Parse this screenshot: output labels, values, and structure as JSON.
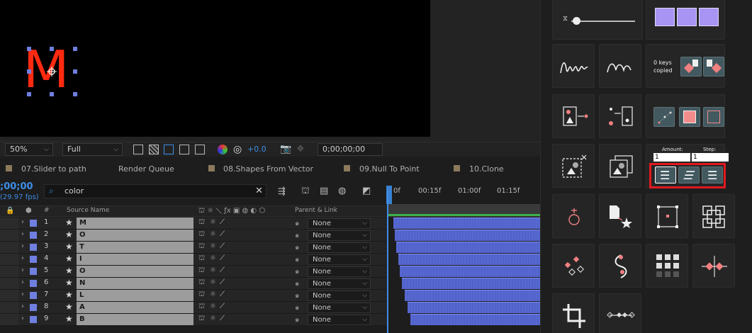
{
  "viewer": {
    "letter": "M",
    "zoom": "50%",
    "resolution": "Full",
    "exposure": "+0.0",
    "timecode": "0;00;00;00"
  },
  "tabs": [
    {
      "label": "07.Slider to path"
    },
    {
      "label": "Render Queue"
    },
    {
      "label": "08.Shapes From Vector"
    },
    {
      "label": "09.Null To Point"
    },
    {
      "label": "10.Clone"
    }
  ],
  "timeline": {
    "timecode": ";00;00",
    "fps": "(29.97 fps)",
    "search_value": "color",
    "ruler": [
      "0f",
      "00:15f",
      "01:00f",
      "01:15f"
    ],
    "columns": {
      "hash": "#",
      "source_name": "Source Name",
      "parent_link": "Parent & Link"
    },
    "layers": [
      {
        "num": "1",
        "name": "M",
        "parent": "None"
      },
      {
        "num": "2",
        "name": "O",
        "parent": "None"
      },
      {
        "num": "3",
        "name": "T",
        "parent": "None"
      },
      {
        "num": "4",
        "name": "I",
        "parent": "None"
      },
      {
        "num": "5",
        "name": "O",
        "parent": "None"
      },
      {
        "num": "6",
        "name": "N",
        "parent": "None"
      },
      {
        "num": "7",
        "name": "L",
        "parent": "None"
      },
      {
        "num": "8",
        "name": "A",
        "parent": "None"
      },
      {
        "num": "9",
        "name": "B",
        "parent": "None"
      }
    ]
  },
  "panel": {
    "keys_copied": "0 keys copied",
    "amount_label": "Amount:",
    "amount_value": "1",
    "step_label": "Step:",
    "step_value": "1"
  },
  "colors": {
    "accent": "#3d8ee6",
    "layer_label": "#6f7fe0",
    "highlight": "#e0191f",
    "purple": "#a894f2"
  }
}
